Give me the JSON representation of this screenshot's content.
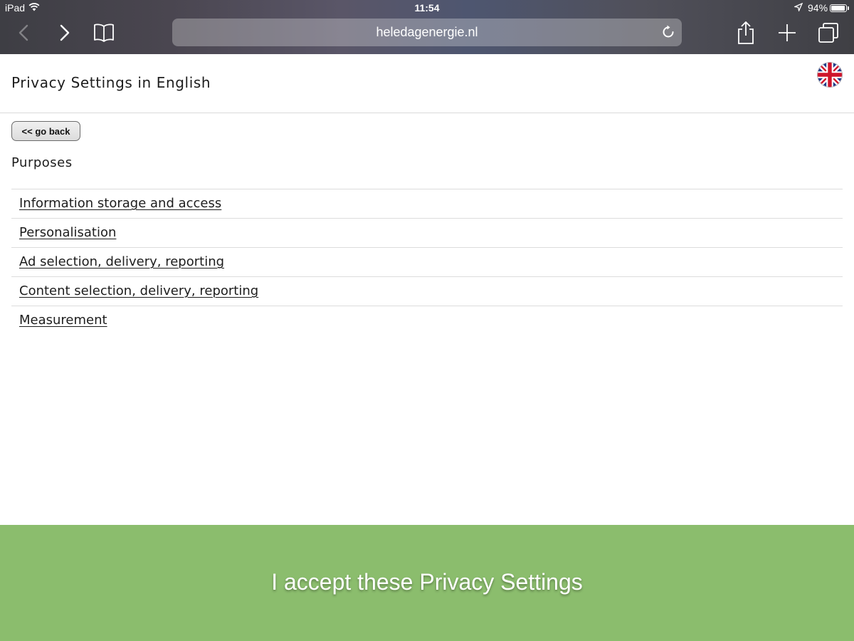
{
  "status_bar": {
    "device": "iPad",
    "time": "11:54",
    "battery": "94%",
    "battery_level": 0.94,
    "icons": [
      "wifi-icon",
      "location-arrow-icon",
      "battery-icon"
    ]
  },
  "browser": {
    "url": "heledagenergie.nl",
    "icons": [
      "back-chevron-icon",
      "forward-chevron-icon",
      "bookmarks-book-icon",
      "reload-icon",
      "share-icon",
      "plus-icon",
      "tabs-icon"
    ]
  },
  "page": {
    "title": "Privacy Settings in English",
    "flag_icon": "uk-flag-icon",
    "go_back_label": "<< go back",
    "section_title": "Purposes",
    "purposes": [
      "Information storage and access",
      "Personalisation",
      "Ad selection, delivery, reporting",
      "Content selection, delivery, reporting",
      "Measurement"
    ],
    "accept_label": "I accept these Privacy Settings"
  },
  "colors": {
    "accept_bar": "#8bbd6d",
    "text": "#1d1d1d",
    "divider": "#dcdcdc"
  }
}
